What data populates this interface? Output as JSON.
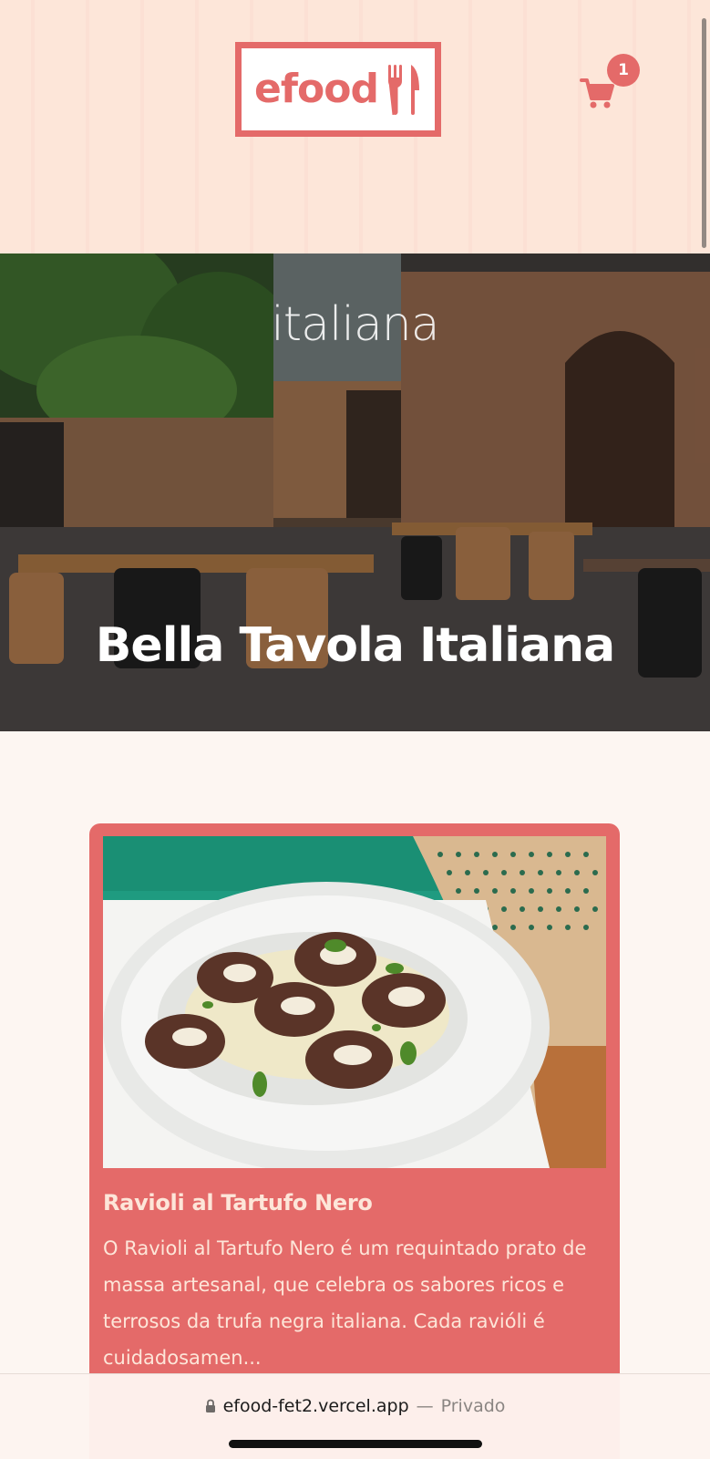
{
  "header": {
    "logo_text": "efood",
    "cart_count": "1"
  },
  "hero": {
    "category": "italiana",
    "title": "Bella Tavola Italiana"
  },
  "menu": {
    "items": [
      {
        "name": "Ravioli al Tartufo Nero",
        "description": "O Ravioli al Tartufo Nero é um requintado prato de massa artesanal, que celebra os sabores ricos e terrosos da trufa negra italiana. Cada ravióli é cuidadosamen..."
      }
    ]
  },
  "browser": {
    "url": "efood-fet2.vercel.app",
    "separator": "—",
    "mode": "Privado"
  },
  "colors": {
    "brand": "#e46a69",
    "header_bg": "#fde6d9",
    "page_bg": "#fdf6f2",
    "card_text": "#fde6d9"
  },
  "icons": [
    "cutlery-icon",
    "cart-icon",
    "lock-icon"
  ]
}
